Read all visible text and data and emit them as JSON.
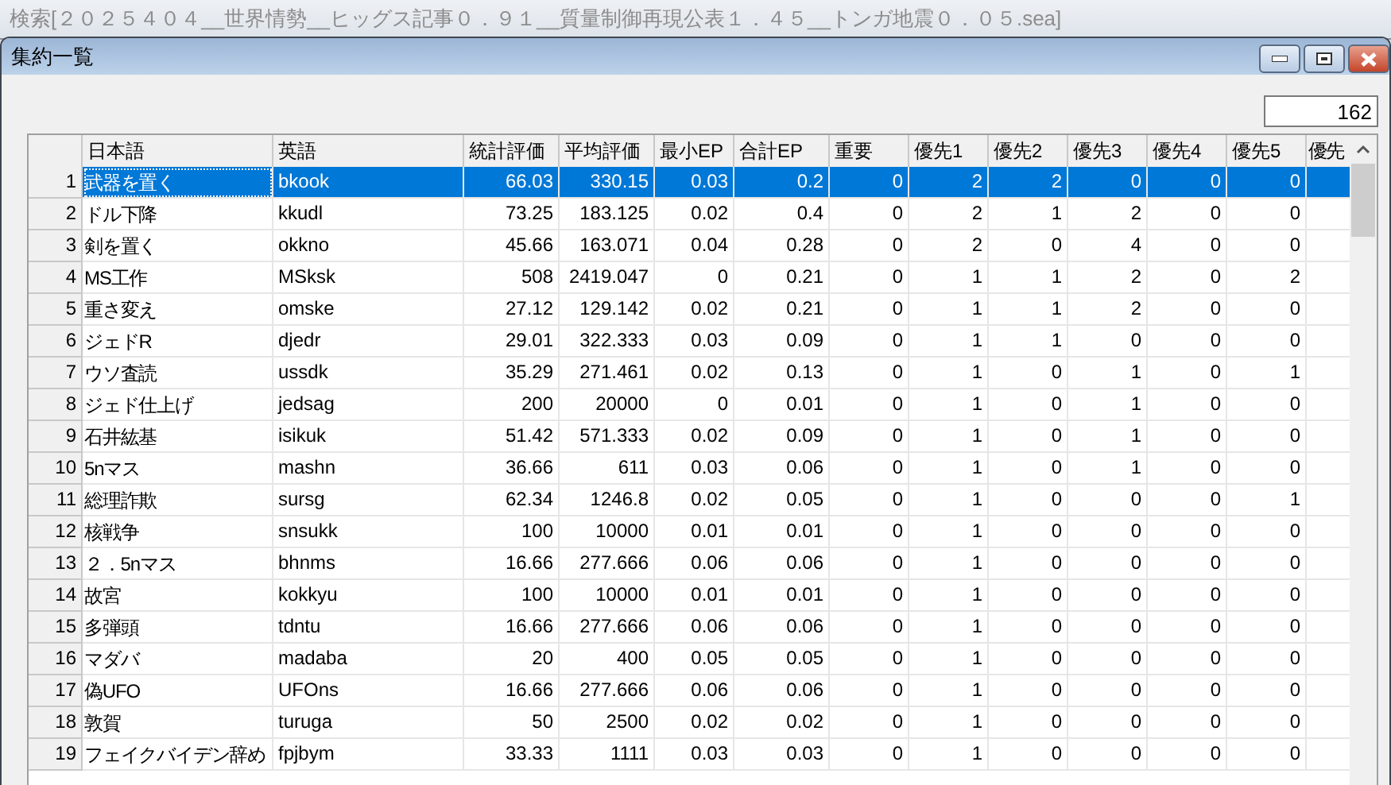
{
  "background_window": {
    "title": "検索[２０２５４０４__世界情勢__ヒッグス記事０．９１__質量制御再現公表１．４５__トンガ地震０．０５.sea]"
  },
  "window": {
    "title": "集約一覧"
  },
  "count": "162",
  "table": {
    "columns": [
      "日本語",
      "英語",
      "統計評価",
      "平均評価",
      "最小EP",
      "合計EP",
      "重要",
      "優先1",
      "優先2",
      "優先3",
      "優先4",
      "優先5",
      "優先"
    ],
    "rows": [
      {
        "number": "1",
        "selected": true,
        "cells": [
          "武器を置く",
          "bkook",
          "66.03",
          "330.15",
          "0.03",
          "0.2",
          "0",
          "2",
          "2",
          "0",
          "0",
          "0"
        ]
      },
      {
        "number": "2",
        "selected": false,
        "cells": [
          "ドル下降",
          "kkudl",
          "73.25",
          "183.125",
          "0.02",
          "0.4",
          "0",
          "2",
          "1",
          "2",
          "0",
          "0"
        ]
      },
      {
        "number": "3",
        "selected": false,
        "cells": [
          "剣を置く",
          "okkno",
          "45.66",
          "163.071",
          "0.04",
          "0.28",
          "0",
          "2",
          "0",
          "4",
          "0",
          "0"
        ]
      },
      {
        "number": "4",
        "selected": false,
        "cells": [
          "MS工作",
          "MSksk",
          "508",
          "2419.047",
          "0",
          "0.21",
          "0",
          "1",
          "1",
          "2",
          "0",
          "2"
        ]
      },
      {
        "number": "5",
        "selected": false,
        "cells": [
          "重さ変え",
          "omske",
          "27.12",
          "129.142",
          "0.02",
          "0.21",
          "0",
          "1",
          "1",
          "2",
          "0",
          "0"
        ]
      },
      {
        "number": "6",
        "selected": false,
        "cells": [
          "ジェドR",
          "djedr",
          "29.01",
          "322.333",
          "0.03",
          "0.09",
          "0",
          "1",
          "1",
          "0",
          "0",
          "0"
        ]
      },
      {
        "number": "7",
        "selected": false,
        "cells": [
          "ウソ査読",
          "ussdk",
          "35.29",
          "271.461",
          "0.02",
          "0.13",
          "0",
          "1",
          "0",
          "1",
          "0",
          "1"
        ]
      },
      {
        "number": "8",
        "selected": false,
        "cells": [
          "ジェド仕上げ",
          "jedsag",
          "200",
          "20000",
          "0",
          "0.01",
          "0",
          "1",
          "0",
          "1",
          "0",
          "0"
        ]
      },
      {
        "number": "9",
        "selected": false,
        "cells": [
          "石井紘基",
          "isikuk",
          "51.42",
          "571.333",
          "0.02",
          "0.09",
          "0",
          "1",
          "0",
          "1",
          "0",
          "0"
        ]
      },
      {
        "number": "10",
        "selected": false,
        "cells": [
          "5nマス",
          "mashn",
          "36.66",
          "611",
          "0.03",
          "0.06",
          "0",
          "1",
          "0",
          "1",
          "0",
          "0"
        ]
      },
      {
        "number": "11",
        "selected": false,
        "cells": [
          "総理詐欺",
          "sursg",
          "62.34",
          "1246.8",
          "0.02",
          "0.05",
          "0",
          "1",
          "0",
          "0",
          "0",
          "1"
        ]
      },
      {
        "number": "12",
        "selected": false,
        "cells": [
          "核戦争",
          "snsukk",
          "100",
          "10000",
          "0.01",
          "0.01",
          "0",
          "1",
          "0",
          "0",
          "0",
          "0"
        ]
      },
      {
        "number": "13",
        "selected": false,
        "cells": [
          "２．5nマス",
          "bhnms",
          "16.66",
          "277.666",
          "0.06",
          "0.06",
          "0",
          "1",
          "0",
          "0",
          "0",
          "0"
        ]
      },
      {
        "number": "14",
        "selected": false,
        "cells": [
          "故宮",
          "kokkyu",
          "100",
          "10000",
          "0.01",
          "0.01",
          "0",
          "1",
          "0",
          "0",
          "0",
          "0"
        ]
      },
      {
        "number": "15",
        "selected": false,
        "cells": [
          "多弾頭",
          "tdntu",
          "16.66",
          "277.666",
          "0.06",
          "0.06",
          "0",
          "1",
          "0",
          "0",
          "0",
          "0"
        ]
      },
      {
        "number": "16",
        "selected": false,
        "cells": [
          "マダバ",
          "madaba",
          "20",
          "400",
          "0.05",
          "0.05",
          "0",
          "1",
          "0",
          "0",
          "0",
          "0"
        ]
      },
      {
        "number": "17",
        "selected": false,
        "cells": [
          "偽UFO",
          "UFOns",
          "16.66",
          "277.666",
          "0.06",
          "0.06",
          "0",
          "1",
          "0",
          "0",
          "0",
          "0"
        ]
      },
      {
        "number": "18",
        "selected": false,
        "cells": [
          "敦賀",
          "turuga",
          "50",
          "2500",
          "0.02",
          "0.02",
          "0",
          "1",
          "0",
          "0",
          "0",
          "0"
        ]
      },
      {
        "number": "19",
        "selected": false,
        "cells": [
          "フェイクバイデン辞め",
          "fpjbym",
          "33.33",
          "1111",
          "0.03",
          "0.03",
          "0",
          "1",
          "0",
          "0",
          "0",
          "0"
        ]
      }
    ]
  }
}
